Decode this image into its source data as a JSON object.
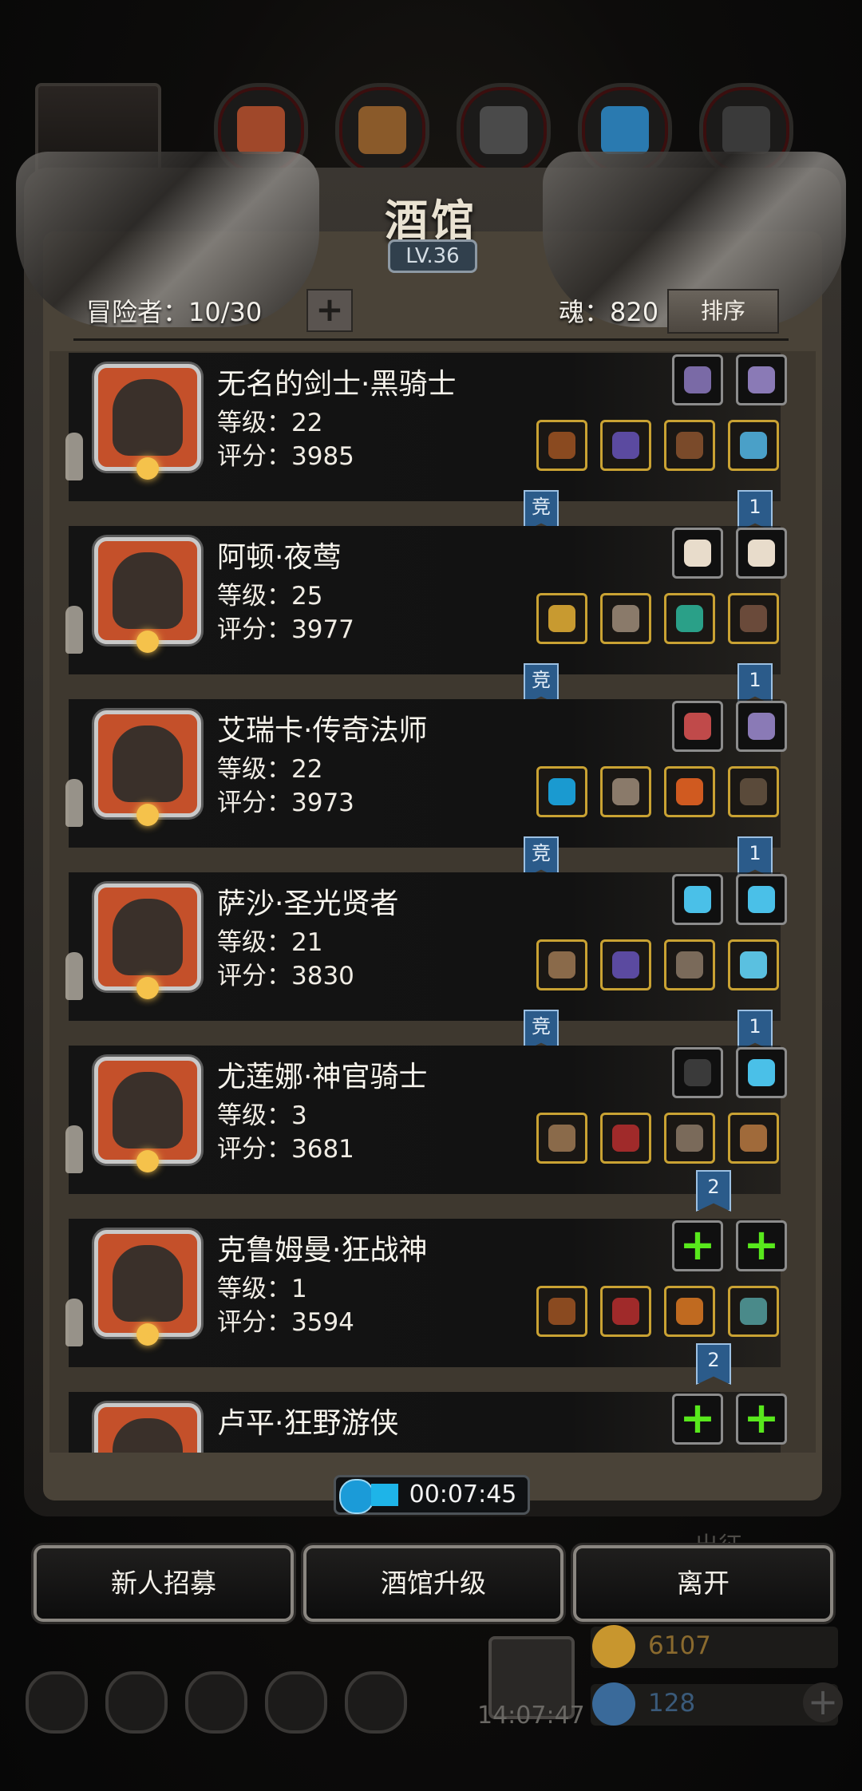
{
  "window": {
    "title": "酒馆",
    "level": "LV.36"
  },
  "header": {
    "adventurers_label": "冒险者：10/30",
    "soul_label": "魂：820",
    "sort_label": "排序"
  },
  "heroes": [
    {
      "name": "无名的剑士·黑骑士",
      "level": "等级：22",
      "score": "评分：3985",
      "ribbon_left": "竞",
      "ribbon_right": "1",
      "top_slots": [
        "#7a6aa6",
        "#8a7ab6"
      ],
      "gear": [
        "#8a4a20",
        "#5b4aa0",
        "#7a4a2a",
        "#4aa0c8"
      ]
    },
    {
      "name": "阿顿·夜莺",
      "level": "等级：25",
      "score": "评分：3977",
      "ribbon_left": "竞",
      "ribbon_right": "1",
      "top_slots": [
        "#e8dccb",
        "#e8dccb"
      ],
      "gear": [
        "#c89a30",
        "#8a7a6a",
        "#2aa088",
        "#6a4a3a"
      ]
    },
    {
      "name": "艾瑞卡·传奇法师",
      "level": "等级：22",
      "score": "评分：3973",
      "ribbon_left": "竞",
      "ribbon_right": "1",
      "top_slots": [
        "#c04a4a",
        "#8a7ab6"
      ],
      "gear": [
        "#1a9ad0",
        "#8a7a6a",
        "#d05a20",
        "#5a4a3a"
      ]
    },
    {
      "name": "萨沙·圣光贤者",
      "level": "等级：21",
      "score": "评分：3830",
      "ribbon_left": "竞",
      "ribbon_right": "1",
      "top_slots": [
        "#4ac0e8",
        "#4ac0e8"
      ],
      "gear": [
        "#8a6a4a",
        "#5b4aa0",
        "#7a6a5a",
        "#5ac0e0"
      ]
    },
    {
      "name": "尤莲娜·神官骑士",
      "level": "等级：3",
      "score": "评分：3681",
      "ribbon_left": "",
      "ribbon_right": "2",
      "top_slots": [
        "#3a3a3a",
        "#4ac0e8"
      ],
      "gear": [
        "#8a6a4a",
        "#a02a2a",
        "#7a6a5a",
        "#a06a3a"
      ]
    },
    {
      "name": "克鲁姆曼·狂战神",
      "level": "等级：1",
      "score": "评分：3594",
      "ribbon_left": "",
      "ribbon_right": "2",
      "top_slots": [
        "add",
        "add"
      ],
      "gear": [
        "#8a4a20",
        "#a02a2a",
        "#c06a20",
        "#4a8a8a"
      ]
    },
    {
      "name": "卢平·狂野游侠",
      "level": "",
      "score": "",
      "ribbon_left": "",
      "ribbon_right": "",
      "top_slots": [
        "add",
        "add"
      ],
      "gear": []
    }
  ],
  "timer": "00:07:45",
  "buttons": {
    "recruit": "新人招募",
    "upgrade": "酒馆升级",
    "leave": "离开"
  },
  "background": {
    "gold": "6107",
    "gems": "128",
    "clock": "14:07:47",
    "hidden_label": "出征"
  },
  "colors": {
    "accent_gold": "#c9a233",
    "ribbon_blue": "#2b5b8a",
    "add_green": "#58e81c"
  }
}
